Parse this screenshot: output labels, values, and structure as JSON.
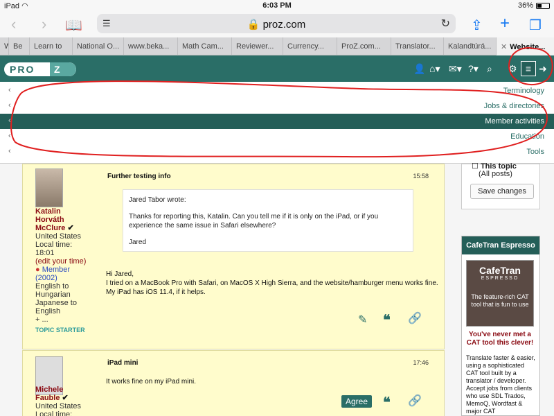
{
  "status": {
    "device": "iPad",
    "time": "6:03 PM",
    "battery": "36%"
  },
  "browser": {
    "url": "proz.com",
    "tabs": [
      {
        "label": "W",
        "w": 0
      },
      {
        "label": "Be"
      },
      {
        "label": "Learn to"
      },
      {
        "label": "National O..."
      },
      {
        "label": "www.beka..."
      },
      {
        "label": "Math Cam..."
      },
      {
        "label": "Reviewer..."
      },
      {
        "label": "Currency..."
      },
      {
        "label": "ProZ.com..."
      },
      {
        "label": "Translator..."
      },
      {
        "label": "Kalandtúrá..."
      },
      {
        "label": "Website..."
      }
    ]
  },
  "logo": {
    "text": "PRO",
    "z": "Z"
  },
  "menu": {
    "items": [
      "Terminology",
      "Jobs & directories",
      "Member activities",
      "Education",
      "Tools"
    ]
  },
  "posts": [
    {
      "author_lines": [
        "Katalin",
        "Horváth",
        "McClure"
      ],
      "country": "United States",
      "local_time_label": "Local time:",
      "local_time": "18:01",
      "edit_time": "(edit your time)",
      "member": "Member",
      "member_year": "(2002)",
      "langs": [
        "English to",
        "Hungarian",
        "Japanese to",
        "English",
        "+ ..."
      ],
      "starter": "TOPIC STARTER",
      "title": "Further testing info",
      "time": "15:58",
      "quote_author": "Jared Tabor wrote:",
      "quote_body": "Thanks for reporting this, Katalin. Can you tell me if it is only on the iPad, or if you experience the same issue in Safari elsewhere?",
      "quote_sign": "Jared",
      "greeting": "Hi Jared,",
      "line1": "I tried on a MacBook Pro with Safari, on MacOS X High Sierra, and the website/hamburger menu works fine.",
      "line2": "My iPad has iOS 11.4, if it helps."
    },
    {
      "author_lines": [
        "Michele",
        "Fauble"
      ],
      "country": "United States",
      "local_time_label": "Local time:",
      "title": "iPad mini",
      "time": "17:46",
      "body": "It works fine on my iPad mini.",
      "agree": "Agree"
    }
  ],
  "sidebar": {
    "this_topic": "This topic",
    "all_posts": "(All posts)",
    "save": "Save changes"
  },
  "ad": {
    "head": "CafeTran Espresso",
    "img_title": "CafeTran",
    "img_sub": "ESPRESSO",
    "img_text": "The feature-rich CAT tool that is fun to use",
    "tagline": "You've never met a CAT tool this clever!",
    "body": "Translate faster & easier, using a sophisticated CAT tool built by a translator / developer. Accept jobs from clients who use SDL Trados, MemoQ, Wordfast & major CAT"
  },
  "colors": {
    "brand": "#2a6e67",
    "author": "#8a0a12",
    "post_bg": "#fffccc",
    "annotation": "#e02020"
  }
}
